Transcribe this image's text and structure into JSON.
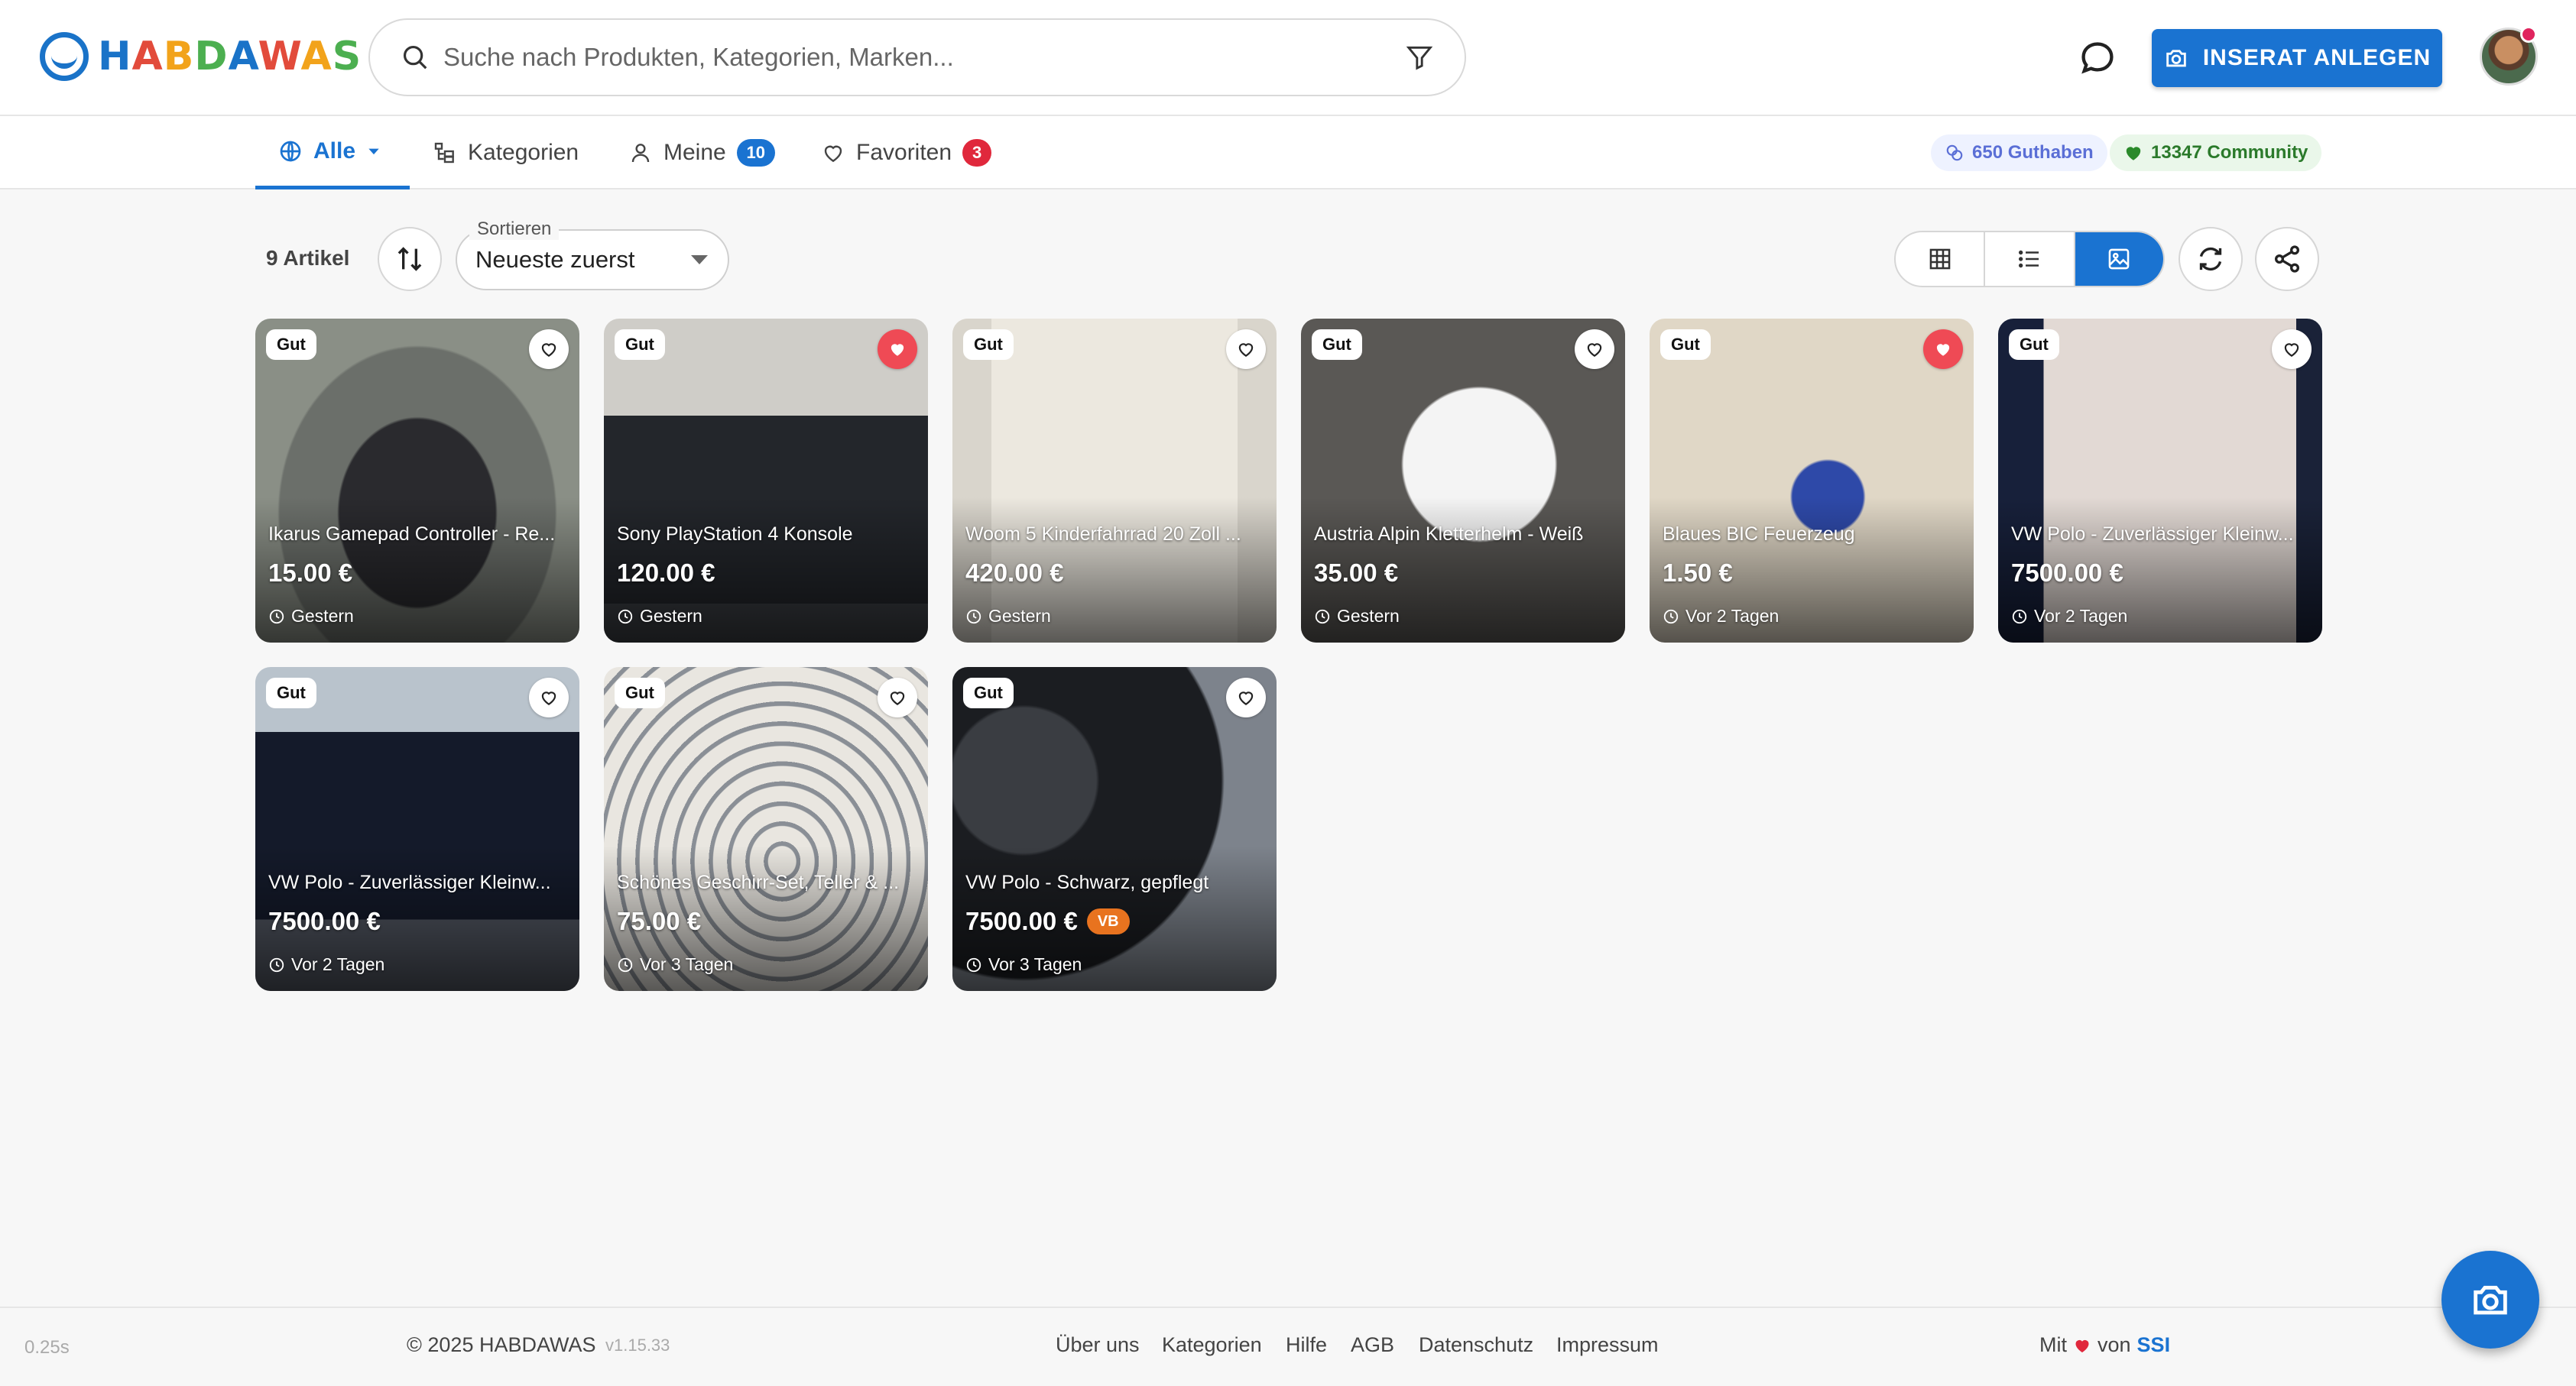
{
  "brand": {
    "name": "HABDAWAS",
    "letters": [
      "H",
      "A",
      "B",
      "D",
      "A",
      "W",
      "A",
      "S"
    ]
  },
  "search": {
    "placeholder": "Suche nach Produkten, Kategorien, Marken..."
  },
  "header": {
    "create_label": "INSERAT ANLEGEN",
    "notification_dot": true
  },
  "tabs": [
    {
      "label": "Alle",
      "active": true,
      "icon": "globe-icon"
    },
    {
      "label": "Kategorien",
      "icon": "category-tree-icon"
    },
    {
      "label": "Meine",
      "badge": "10",
      "icon": "user-icon"
    },
    {
      "label": "Favoriten",
      "badge": "3",
      "icon": "heart-outline-icon"
    }
  ],
  "stats": {
    "credit": "650 Guthaben",
    "community": "13347 Community"
  },
  "toolbar": {
    "count": "9 Artikel",
    "sort_label": "Sortieren",
    "sort_value": "Neueste zuerst",
    "active_view": "gallery"
  },
  "items": [
    {
      "condition": "Gut",
      "title": "Ikarus Gamepad Controller - Re...",
      "price": "15.00 €",
      "time": "Gestern",
      "favorite": false,
      "vb": ""
    },
    {
      "condition": "Gut",
      "title": "Sony PlayStation 4 Konsole",
      "price": "120.00 €",
      "time": "Gestern",
      "favorite": true,
      "vb": ""
    },
    {
      "condition": "Gut",
      "title": "Woom 5 Kinderfahrrad 20 Zoll ...",
      "price": "420.00 €",
      "time": "Gestern",
      "favorite": false,
      "vb": ""
    },
    {
      "condition": "Gut",
      "title": "Austria Alpin Kletterhelm - Weiß",
      "price": "35.00 €",
      "time": "Gestern",
      "favorite": false,
      "vb": ""
    },
    {
      "condition": "Gut",
      "title": "Blaues BIC Feuerzeug",
      "price": "1.50 €",
      "time": "Vor 2 Tagen",
      "favorite": true,
      "vb": ""
    },
    {
      "condition": "Gut",
      "title": "VW Polo - Zuverlässiger Kleinw...",
      "price": "7500.00 €",
      "time": "Vor 2 Tagen",
      "favorite": false,
      "vb": ""
    },
    {
      "condition": "Gut",
      "title": "VW Polo - Zuverlässiger Kleinw...",
      "price": "7500.00 €",
      "time": "Vor 2 Tagen",
      "favorite": false,
      "vb": ""
    },
    {
      "condition": "Gut",
      "title": "Schönes Geschirr-Set, Teller & ...",
      "price": "75.00 €",
      "time": "Vor 3 Tagen",
      "favorite": false,
      "vb": ""
    },
    {
      "condition": "Gut",
      "title": "VW Polo - Schwarz, gepflegt",
      "price": "7500.00 €",
      "time": "Vor 3 Tagen",
      "favorite": false,
      "vb": "VB"
    }
  ],
  "footer": {
    "timing": "0.25s",
    "copyright": "© 2025 HABDAWAS",
    "version": "v1.15.33",
    "links": [
      "Über uns",
      "Kategorien",
      "Hilfe",
      "AGB",
      "Datenschutz",
      "Impressum"
    ],
    "made_prefix": "Mit",
    "made_mid": "von",
    "made_by": "SSI"
  },
  "colors": {
    "accent": "#1a73d1",
    "favorite": "#ef4a55",
    "vb": "#e8731f"
  }
}
